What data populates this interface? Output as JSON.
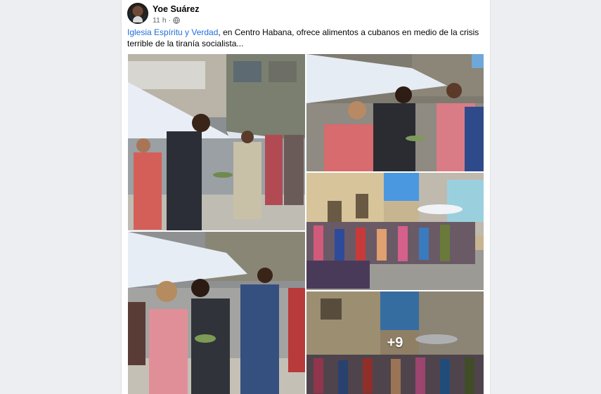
{
  "post": {
    "author": "Yoe Suárez",
    "time": "11 h",
    "separator": "·",
    "privacy_icon": "globe-icon",
    "caption_link": "Iglesia Espíritu y Verdad",
    "caption_text": ", en Centro Habana, ofrece alimentos a cubanos en medio de la crisis terrible de la tiranía socialista..."
  },
  "gallery": {
    "more_count": "+9"
  },
  "colors": {
    "link": "#216fdb",
    "background": "#eceef1",
    "card": "#ffffff",
    "meta": "#65676b"
  }
}
